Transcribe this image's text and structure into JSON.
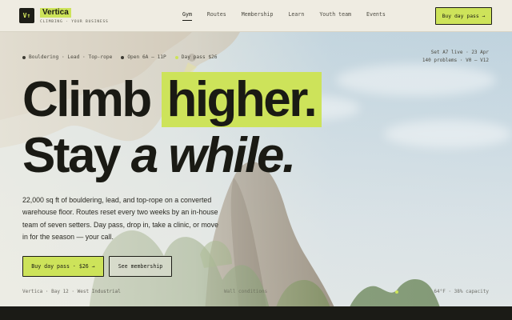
{
  "brand": {
    "mark": "V↑",
    "name": "Vertica",
    "tagline": "CLIMBING · YOUR BUSINESS"
  },
  "nav": {
    "items": [
      {
        "label": "Gym",
        "active": true
      },
      {
        "label": "Routes",
        "active": false
      },
      {
        "label": "Membership",
        "active": false
      },
      {
        "label": "Learn",
        "active": false
      },
      {
        "label": "Youth team",
        "active": false
      },
      {
        "label": "Events",
        "active": false
      }
    ],
    "cta_label": "Buy day pass →"
  },
  "info": {
    "disciplines": "Bouldering · Lead · Top-rope",
    "hours": "Open 6A – 11P",
    "day_pass": "Day pass $26",
    "set_status": "Set A7 live · 23 Apr",
    "problems": "140 problems · V0 – V12"
  },
  "hero": {
    "line1_plain": "Climb ",
    "line1_highlight": "higher.",
    "line2_plain": "Stay ",
    "line2_italic": "a while.",
    "description": "22,000 sq ft of bouldering, lead, and top-rope on a converted warehouse floor. Routes reset every two weeks by an in-house team of seven setters. Day pass, drop in, take a clinic, or move in for the season — your call.",
    "primary_cta": "Buy day pass · $26 →",
    "secondary_cta": "See membership"
  },
  "status": {
    "location": "Vertica · Bay 12 · West Industrial",
    "middle": "Wall conditions",
    "capacity": "64°F · 38% capacity"
  },
  "colors": {
    "accent": "#cde35a",
    "ink": "#1a1a14",
    "header_bg": "#efece2"
  }
}
